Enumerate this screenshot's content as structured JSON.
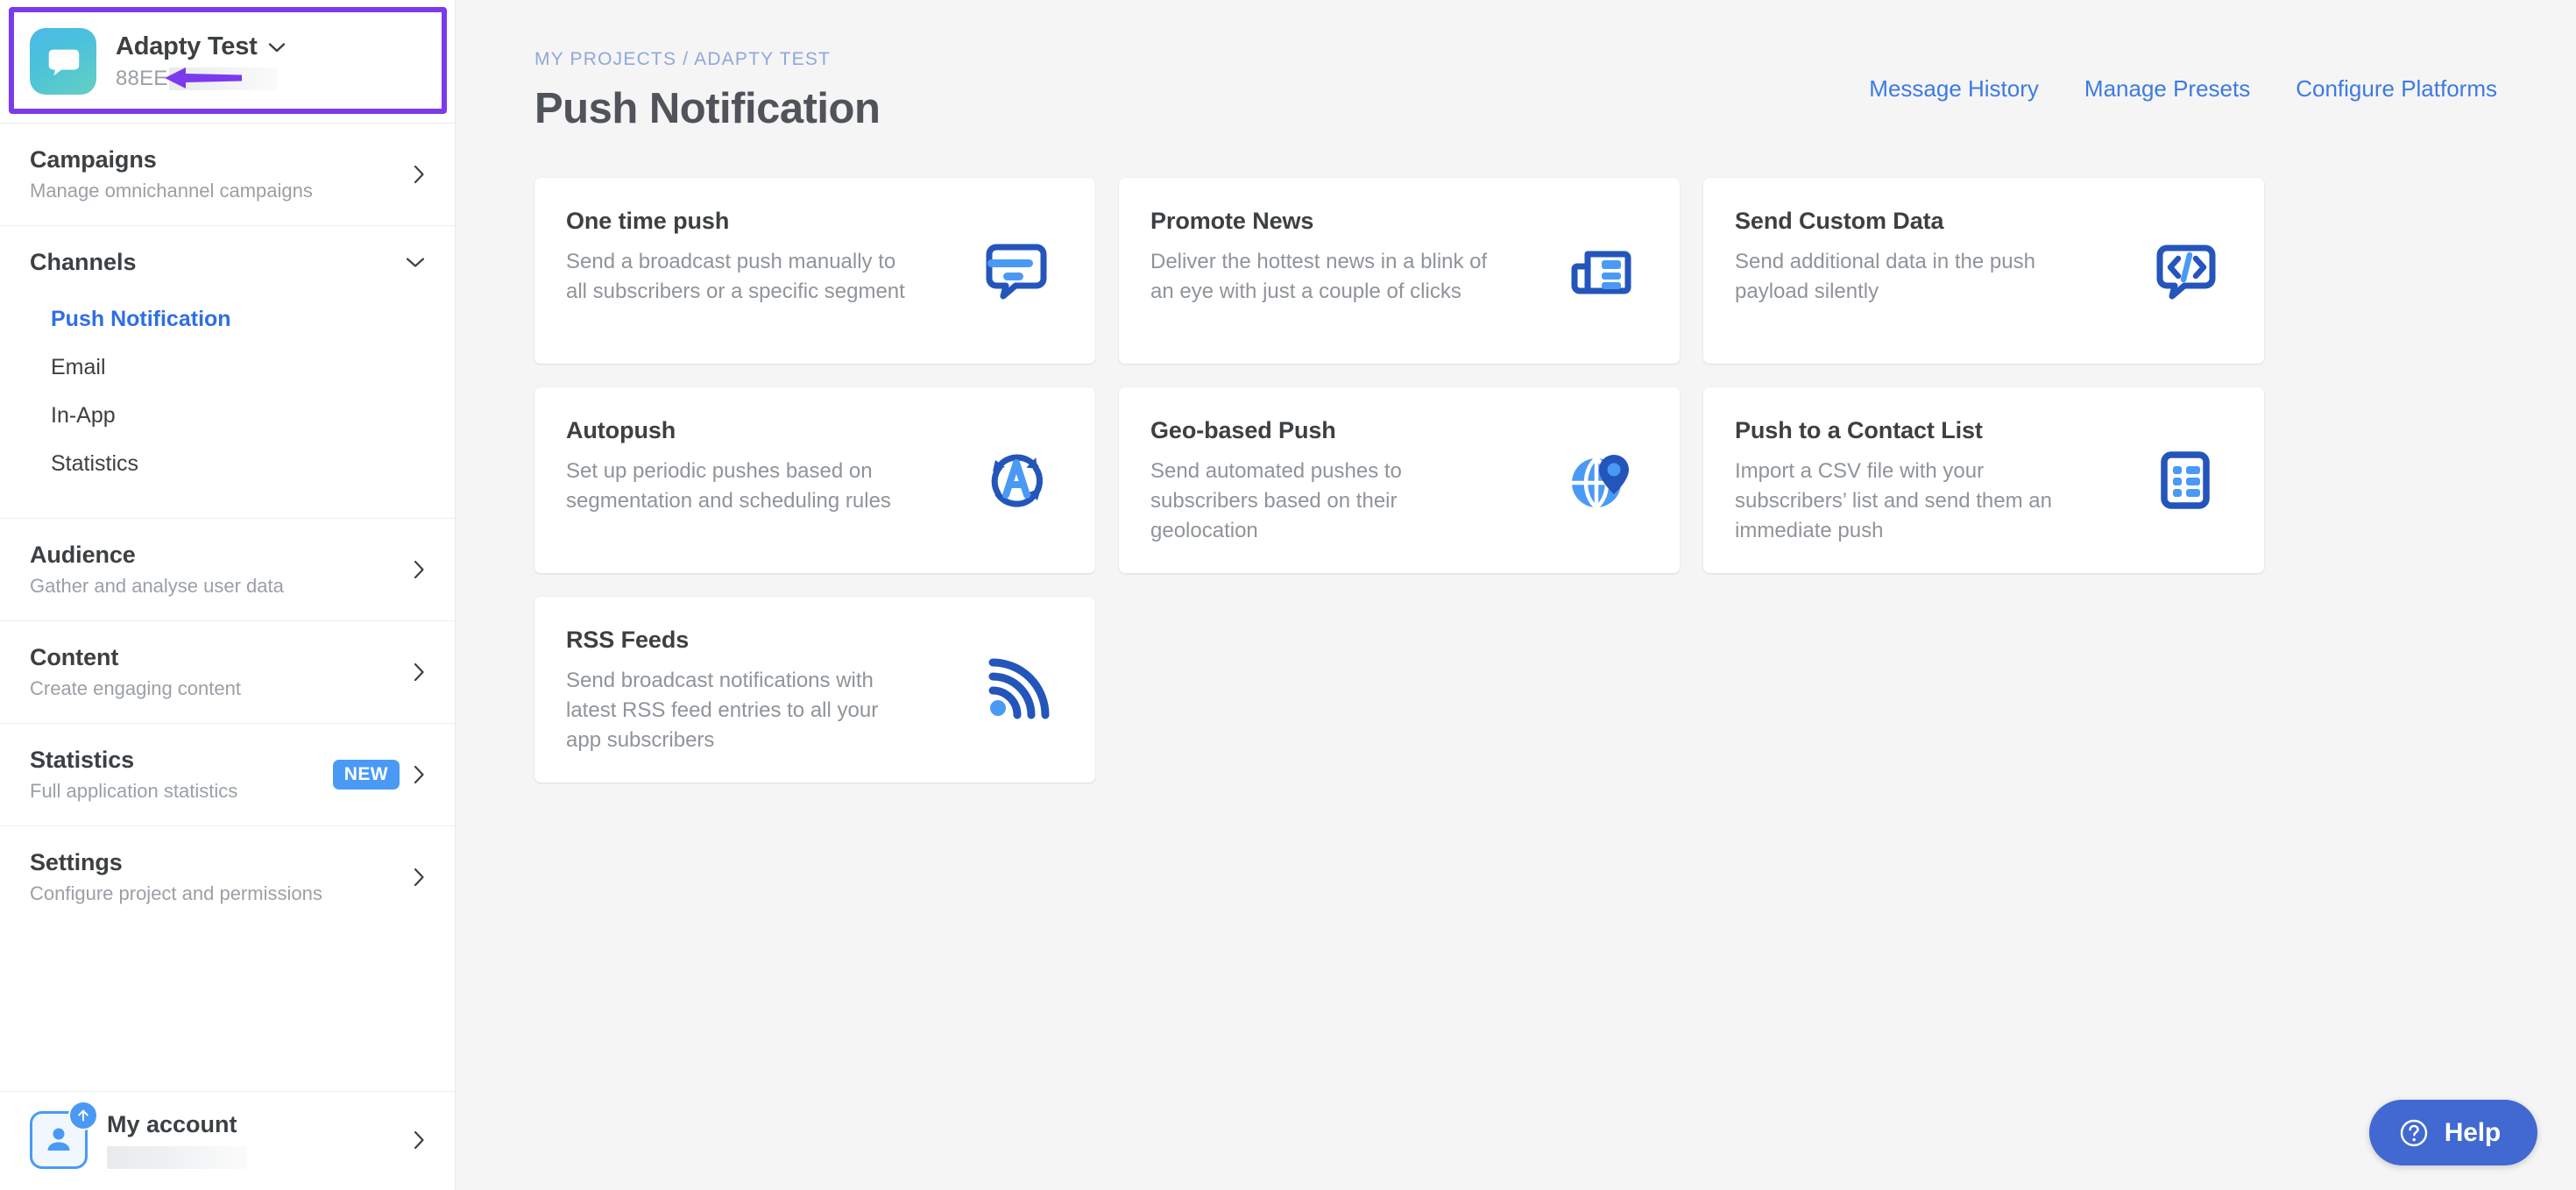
{
  "sidebar": {
    "project": {
      "name": "Adapty Test",
      "id_prefix": "88EE",
      "app_icon": "speech-bubble-icon",
      "dropdown_icon": "chevron-down-icon",
      "annotation_icon": "purple-arrow-pointing-left"
    },
    "sections": [
      {
        "title": "Campaigns",
        "subtitle": "Manage omnichannel campaigns",
        "chevron": "chevron-right-icon"
      },
      {
        "title": "Audience",
        "subtitle": "Gather and analyse user data",
        "chevron": "chevron-right-icon"
      },
      {
        "title": "Content",
        "subtitle": "Create engaging content",
        "chevron": "chevron-right-icon"
      },
      {
        "title": "Statistics",
        "subtitle": "Full application statistics",
        "badge": "NEW",
        "chevron": "chevron-right-icon"
      },
      {
        "title": "Settings",
        "subtitle": "Configure project and permissions",
        "chevron": "chevron-right-icon"
      }
    ],
    "channels": {
      "title": "Channels",
      "chevron": "chevron-down-icon",
      "items": [
        {
          "label": "Push Notification",
          "active": true
        },
        {
          "label": "Email",
          "active": false
        },
        {
          "label": "In-App",
          "active": false
        },
        {
          "label": "Statistics",
          "active": false
        }
      ]
    },
    "account": {
      "title": "My account",
      "avatar_icon": "person-icon",
      "badge_icon": "arrow-up-icon",
      "chevron": "chevron-right-icon"
    }
  },
  "header": {
    "breadcrumb": "MY PROJECTS / ADAPTY TEST",
    "title": "Push Notification",
    "links": [
      "Message History",
      "Manage Presets",
      "Configure Platforms"
    ]
  },
  "cards": [
    {
      "title": "One time push",
      "description": "Send a broadcast push manually to all subscribers or a specific segment",
      "icon": "push-message-icon"
    },
    {
      "title": "Promote News",
      "description": "Deliver the hottest news in a blink of an eye with just a couple of clicks",
      "icon": "newspaper-icon"
    },
    {
      "title": "Send Custom Data",
      "description": "Send additional data in the push payload silently",
      "icon": "code-bubble-icon"
    },
    {
      "title": "Autopush",
      "description": "Set up periodic pushes based on segmentation and scheduling rules",
      "icon": "auto-refresh-a-icon"
    },
    {
      "title": "Geo-based Push",
      "description": "Send automated pushes to subscribers based on their geolocation",
      "icon": "globe-pin-icon"
    },
    {
      "title": "Push to a Contact List",
      "description": "Import a CSV file with your subscribers’ list and send them an immediate push",
      "icon": "contact-list-icon"
    },
    {
      "title": "RSS Feeds",
      "description": "Send broadcast notifications with latest RSS feed entries to all your app subscribers",
      "icon": "rss-icon"
    }
  ],
  "help": {
    "label": "Help",
    "icon": "question-circle-icon"
  },
  "colors": {
    "accent_blue": "#3d7ae4",
    "icon_dark_blue": "#2455bb",
    "icon_light_blue": "#4a9af5",
    "badge_blue": "#4a9af5",
    "help_blue": "#4269d1",
    "highlight_purple": "#7c3aed",
    "page_bg": "#f5f5f5",
    "sidebar_bg": "#ffffff",
    "text_dark": "#3c4043",
    "text_muted": "#9aa0a6"
  }
}
